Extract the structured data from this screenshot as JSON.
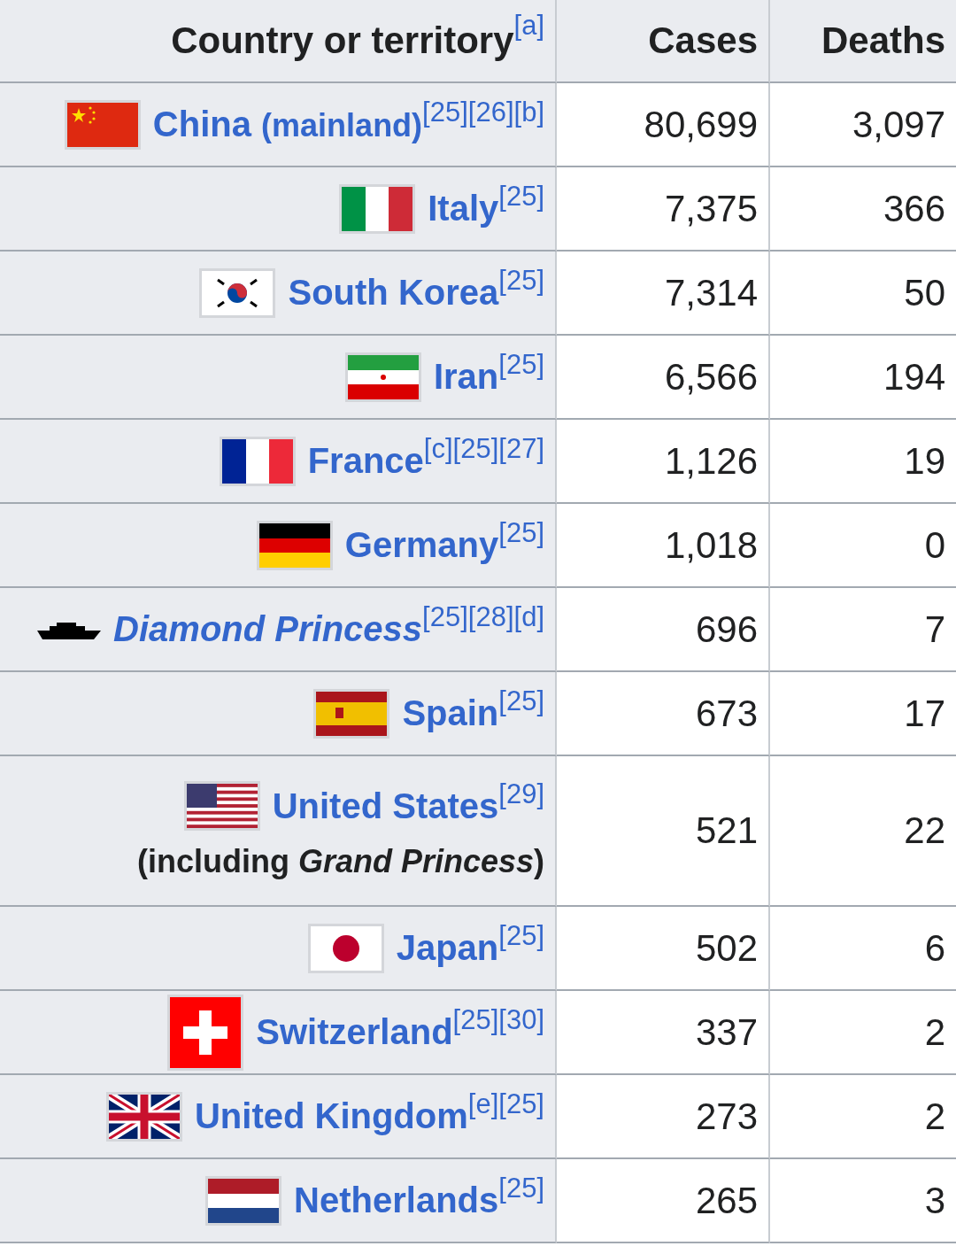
{
  "table": {
    "columns": [
      {
        "label": "Country or territory",
        "refs": "[a]"
      },
      {
        "label": "Cases"
      },
      {
        "label": "Deaths"
      }
    ],
    "rows": [
      {
        "kind": "china",
        "name": "China",
        "suffix": "(mainland)",
        "refs": "[25][26][b]",
        "cases": "80,699",
        "deaths": "3,097"
      },
      {
        "kind": "italy",
        "name": "Italy",
        "refs": "[25]",
        "cases": "7,375",
        "deaths": "366"
      },
      {
        "kind": "south_korea",
        "name": "South Korea",
        "refs": "[25]",
        "cases": "7,314",
        "deaths": "50"
      },
      {
        "kind": "iran",
        "name": "Iran",
        "refs": "[25]",
        "cases": "6,566",
        "deaths": "194"
      },
      {
        "kind": "france",
        "name": "France",
        "refs": "[c][25][27]",
        "cases": "1,126",
        "deaths": "19"
      },
      {
        "kind": "germany",
        "name": "Germany",
        "refs": "[25]",
        "cases": "1,018",
        "deaths": "0"
      },
      {
        "kind": "ship",
        "name": "Diamond Princess",
        "italic": true,
        "refs": "[25][28][d]",
        "cases": "696",
        "deaths": "7"
      },
      {
        "kind": "spain",
        "name": "Spain",
        "refs": "[25]",
        "cases": "673",
        "deaths": "17"
      },
      {
        "kind": "usa",
        "name": "United States",
        "refs": "[29]",
        "note": "(including *Grand Princess*)",
        "cases": "521",
        "deaths": "22"
      },
      {
        "kind": "japan",
        "name": "Japan",
        "refs": "[25]",
        "cases": "502",
        "deaths": "6"
      },
      {
        "kind": "switzerland",
        "name": "Switzerland",
        "refs": "[25][30]",
        "cases": "337",
        "deaths": "2"
      },
      {
        "kind": "uk",
        "name": "United Kingdom",
        "refs": "[e][25]",
        "cases": "273",
        "deaths": "2"
      },
      {
        "kind": "netherlands",
        "name": "Netherlands",
        "refs": "[25]",
        "cases": "265",
        "deaths": "3"
      }
    ]
  }
}
